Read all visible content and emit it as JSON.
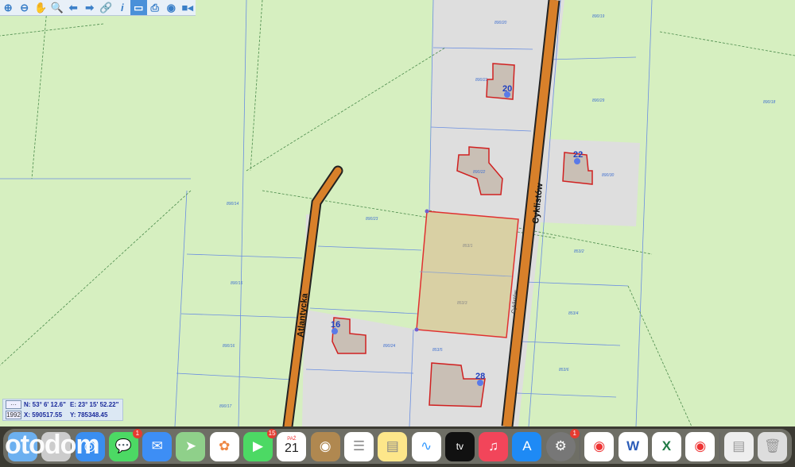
{
  "toolbar": {
    "items": [
      "zoom-in",
      "zoom-out",
      "pan",
      "zoom-window",
      "back",
      "forward",
      "link",
      "info",
      "measure",
      "print",
      "globe",
      "video"
    ],
    "active": "measure"
  },
  "streets": {
    "main": "Cyklistów",
    "main_small": "Cyklistów",
    "side": "Atlantycka"
  },
  "house_numbers": [
    "20",
    "22",
    "16",
    "28"
  ],
  "parcels": [
    "890/20",
    "890/21",
    "890/29",
    "890/30",
    "890/22",
    "890/19",
    "853/1",
    "853/3",
    "853/2",
    "853/4",
    "853/5",
    "890/23",
    "890/24",
    "890/14",
    "890/15",
    "890/16",
    "890/17",
    "890/18",
    "853/6"
  ],
  "coords": {
    "epsg_btn": "1992",
    "n": "N: 53° 6' 12.6\"",
    "e": "E: 23° 15' 52.22\"",
    "x": "X: 590517.55",
    "y": "Y: 785348.45"
  },
  "dock": {
    "apps": [
      {
        "name": "finder"
      },
      {
        "name": "launchpad"
      },
      {
        "name": "safari"
      },
      {
        "name": "messages",
        "badge": "1"
      },
      {
        "name": "mail"
      },
      {
        "name": "maps"
      },
      {
        "name": "photos"
      },
      {
        "name": "facetime",
        "badge": "15"
      },
      {
        "name": "calendar",
        "month": "PAŹ",
        "day": "21"
      },
      {
        "name": "contacts"
      },
      {
        "name": "reminders"
      },
      {
        "name": "notes"
      },
      {
        "name": "freeform"
      },
      {
        "name": "tv",
        "label": "tv"
      },
      {
        "name": "music"
      },
      {
        "name": "app-store"
      },
      {
        "name": "system-settings",
        "badge": "1"
      },
      {
        "name": "chrome"
      },
      {
        "name": "word",
        "label": "W"
      },
      {
        "name": "excel",
        "label": "X"
      },
      {
        "name": "chrome-2"
      },
      {
        "name": "document"
      },
      {
        "name": "trash"
      }
    ]
  },
  "watermark": "otodom",
  "colors": {
    "land": "#d6efc0",
    "road_area": "#dedede",
    "road": "#d8802a",
    "selected": "#d9d0a4",
    "boundary": "#e03030"
  }
}
